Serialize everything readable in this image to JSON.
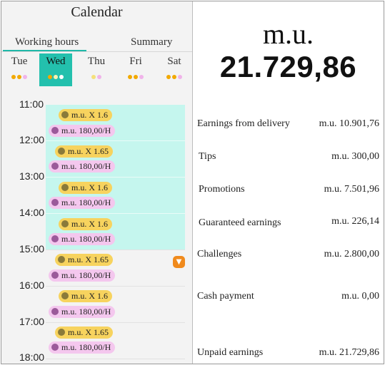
{
  "calendar": {
    "title": "Calendar",
    "tabs": [
      "Working hours",
      "Summary"
    ],
    "days": [
      {
        "label": "Tue",
        "selected": false
      },
      {
        "label": "Wed",
        "selected": true
      },
      {
        "label": "Thu",
        "selected": false
      },
      {
        "label": "Fri",
        "selected": false
      },
      {
        "label": "Sat",
        "selected": false
      }
    ],
    "times": [
      "11:00",
      "12:00",
      "13:00",
      "14:00",
      "15:00",
      "16:00",
      "17:00",
      "18:00"
    ],
    "slots": [
      {
        "multiplier": "m.u. X 1.6",
        "rate": "m.u. 180,00/H"
      },
      {
        "multiplier": "m.u. X 1.65",
        "rate": "m.u. 180,00/H"
      },
      {
        "multiplier": "m.u. X 1.6",
        "rate": "m.u. 180,00/H"
      },
      {
        "multiplier": "m.u. X 1.6",
        "rate": "m.u. 180,00/H"
      },
      {
        "multiplier": "m.u. X 1.65",
        "rate": "m.u. 180,00/H"
      },
      {
        "multiplier": "m.u. X 1.6",
        "rate": "m.u. 180,00/H"
      },
      {
        "multiplier": "m.u. X 1.65",
        "rate": "m.u. 180,00/H"
      }
    ],
    "colors": {
      "accent": "#23c0ad",
      "shift_bg": "#c5f6ee",
      "multiplier_chip": "#f7d35e",
      "rate_chip": "#f4c7ee",
      "alert": "#f08a1c"
    }
  },
  "summary": {
    "currency": "m.u.",
    "total": "21.729,86",
    "rows": [
      {
        "label": "Earnings from delivery",
        "value": "m.u. 10.901,76"
      },
      {
        "label": "Tips",
        "value": "m.u. 300,00"
      },
      {
        "label": "Promotions",
        "value": "m.u. 7.501,96"
      },
      {
        "label": "Guaranteed earnings",
        "value": "m.u. 226,14"
      },
      {
        "label": "Challenges",
        "value": "m.u. 2.800,00"
      },
      {
        "label": "Cash payment",
        "value": "m.u. 0,00"
      },
      {
        "label": "Unpaid earnings",
        "value": "m.u. 21.729,86"
      }
    ]
  }
}
